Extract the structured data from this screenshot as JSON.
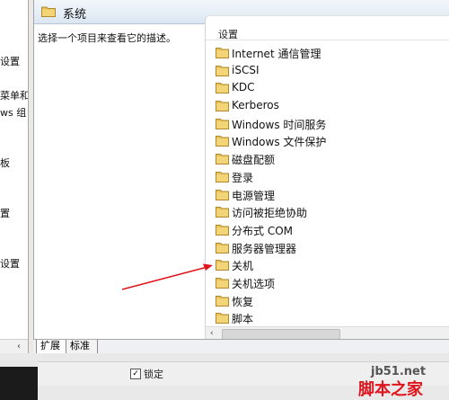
{
  "left_pane": {
    "items": [
      "设置",
      "菜单和",
      "ws 组",
      "板",
      "置",
      "设置"
    ],
    "scroll_arrow": "‹"
  },
  "header": {
    "icon": "folder-icon",
    "title": "系统"
  },
  "description": "选择一个项目来查看它的描述。",
  "list": {
    "column_header": "设置",
    "items": [
      "Internet 通信管理",
      "iSCSI",
      "KDC",
      "Kerberos",
      "Windows 时间服务",
      "Windows 文件保护",
      "磁盘配额",
      "登录",
      "电源管理",
      "访问被拒绝协助",
      "分布式 COM",
      "服务器管理器",
      "关机",
      "关机选项",
      "恢复",
      "脚本"
    ],
    "scroll_left": "‹"
  },
  "tabs": [
    {
      "label": "扩展"
    },
    {
      "label": "标准"
    }
  ],
  "bottom": {
    "check_mark": "✓",
    "label": "锁定"
  },
  "watermark": {
    "site": "jb51.net",
    "brand": "脚本之家"
  },
  "colors": {
    "folder": "#e8c25a",
    "arrow": "#e0141c",
    "watermark": "#e0141c"
  }
}
